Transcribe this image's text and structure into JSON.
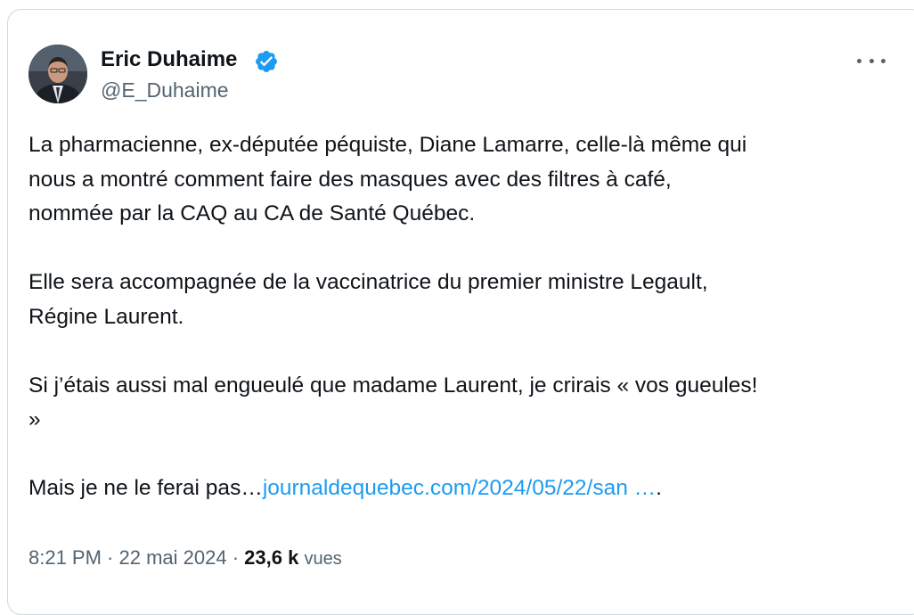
{
  "author": {
    "name": "Eric Duhaime",
    "handle": "@E_Duhaime",
    "verified_color": "#1d9bf0"
  },
  "tweet": {
    "paragraph_1": "La pharmacienne, ex-députée péquiste, Diane Lamarre, celle-là même qui\nnous a montré comment faire des masques avec des filtres à café,\nnommée par la CAQ au CA de Santé Québec.",
    "paragraph_2": "Elle sera accompagnée de la vaccinatrice du premier ministre Legault,\nRégine Laurent.",
    "paragraph_3": "Si j’étais aussi mal engueulé que madame Laurent, je crirais « vos gueules!\n»",
    "paragraph_4_prefix": "Mais je ne le ferai pas…",
    "link_text": "journaldequebec.com/2024/05/22/san …",
    "paragraph_4_suffix": "."
  },
  "meta": {
    "time": "8:21 PM",
    "separator_1": " · ",
    "date": "22 mai 2024",
    "separator_2": " · ",
    "views_count": "23,6 k",
    "views_label": "vues"
  },
  "colors": {
    "text": "#0f1419",
    "secondary": "#536471",
    "link": "#1d9bf0",
    "border": "#cfd9de"
  }
}
